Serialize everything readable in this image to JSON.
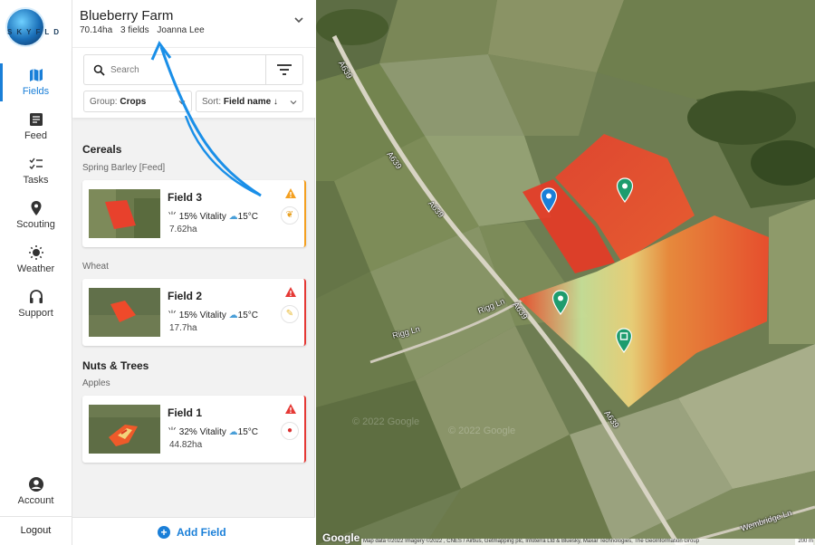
{
  "nav": {
    "logo_text": "SKYFLD",
    "items": [
      {
        "label": "Fields",
        "icon": "map-icon",
        "active": true
      },
      {
        "label": "Feed",
        "icon": "feed-icon"
      },
      {
        "label": "Tasks",
        "icon": "tasks-icon"
      },
      {
        "label": "Scouting",
        "icon": "location-pin-icon"
      },
      {
        "label": "Weather",
        "icon": "sun-icon"
      },
      {
        "label": "Support",
        "icon": "headset-icon"
      },
      {
        "label": "Account",
        "icon": "account-icon"
      }
    ],
    "logout": "Logout"
  },
  "farm": {
    "name": "Blueberry Farm",
    "area": "70.14ha",
    "fields_count": "3 fields",
    "owner": "Joanna Lee"
  },
  "search": {
    "placeholder": "Search"
  },
  "group_dropdown": {
    "label": "Group:",
    "value": "Crops"
  },
  "sort_dropdown": {
    "label": "Sort:",
    "value": "Field name ↓"
  },
  "groups": [
    {
      "title": "Cereals",
      "subgroups": [
        {
          "crop": "Spring Barley [Feed]",
          "fields": [
            {
              "name": "Field 3",
              "vitality": "15% Vitality",
              "temp": "15°C",
              "area": "7.62ha",
              "status": "warning",
              "crop_icon": "barley-icon"
            }
          ]
        },
        {
          "crop": "Wheat",
          "fields": [
            {
              "name": "Field 2",
              "vitality": "15% Vitality",
              "temp": "15°C",
              "area": "17.7ha",
              "status": "critical",
              "crop_icon": "wheat-icon"
            }
          ]
        }
      ]
    },
    {
      "title": "Nuts & Trees",
      "subgroups": [
        {
          "crop": "Apples",
          "fields": [
            {
              "name": "Field 1",
              "vitality": "32% Vitality",
              "temp": "15°C",
              "area": "44.82ha",
              "status": "critical",
              "crop_icon": "apple-icon"
            }
          ]
        }
      ]
    }
  ],
  "add_field": "Add Field",
  "map": {
    "road_labels": [
      "A639",
      "A639",
      "A639",
      "A639",
      "A639",
      "Rigg Ln",
      "Rigg Ln",
      "Wembridge Ln"
    ],
    "google": "Google",
    "attribution": "Map data ©2022 Imagery ©2022 , CNES / Airbus, Getmapping plc, Infoterra Ltd & Bluesky, Maxar Technologies, The GeoInformation Group",
    "scale": "200 m",
    "watermark": "© 2022 Google"
  },
  "colors": {
    "accent": "#1a7fd8",
    "warning": "#f4a020",
    "critical": "#e53935"
  }
}
